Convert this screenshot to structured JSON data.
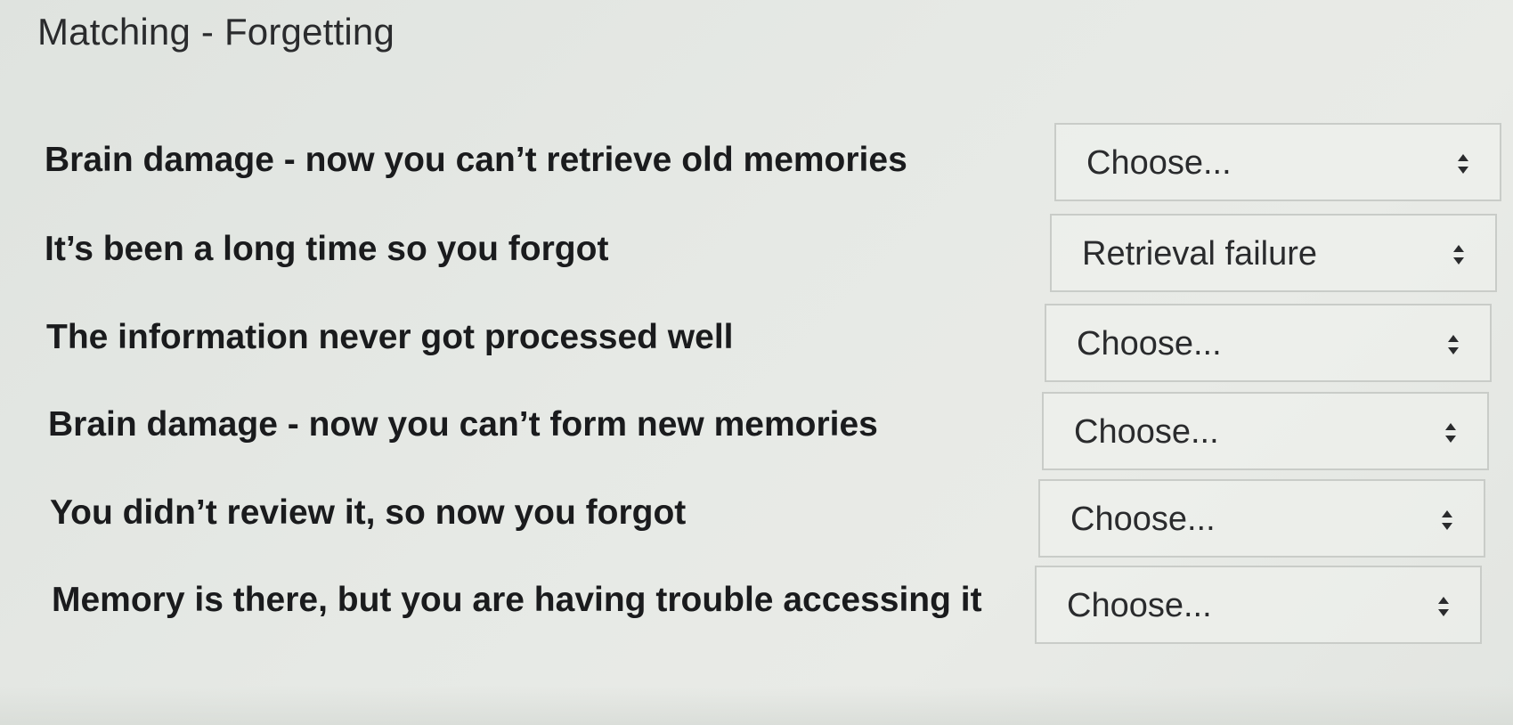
{
  "question": {
    "title": "Matching - Forgetting"
  },
  "rows": [
    {
      "stem": "Brain damage - now you can’t retrieve old memories",
      "selected": "Choose..."
    },
    {
      "stem": "It’s been a long time so you forgot",
      "selected": "Retrieval failure"
    },
    {
      "stem": "The information never got processed well",
      "selected": "Choose..."
    },
    {
      "stem": "Brain damage - now you can’t form new memories",
      "selected": "Choose..."
    },
    {
      "stem": "You didn’t review it, so now you forgot",
      "selected": "Choose..."
    },
    {
      "stem": "Memory is there, but you are having trouble accessing it",
      "selected": "Choose..."
    }
  ],
  "icons": {
    "select_arrow": "up-down-chevron-icon"
  }
}
